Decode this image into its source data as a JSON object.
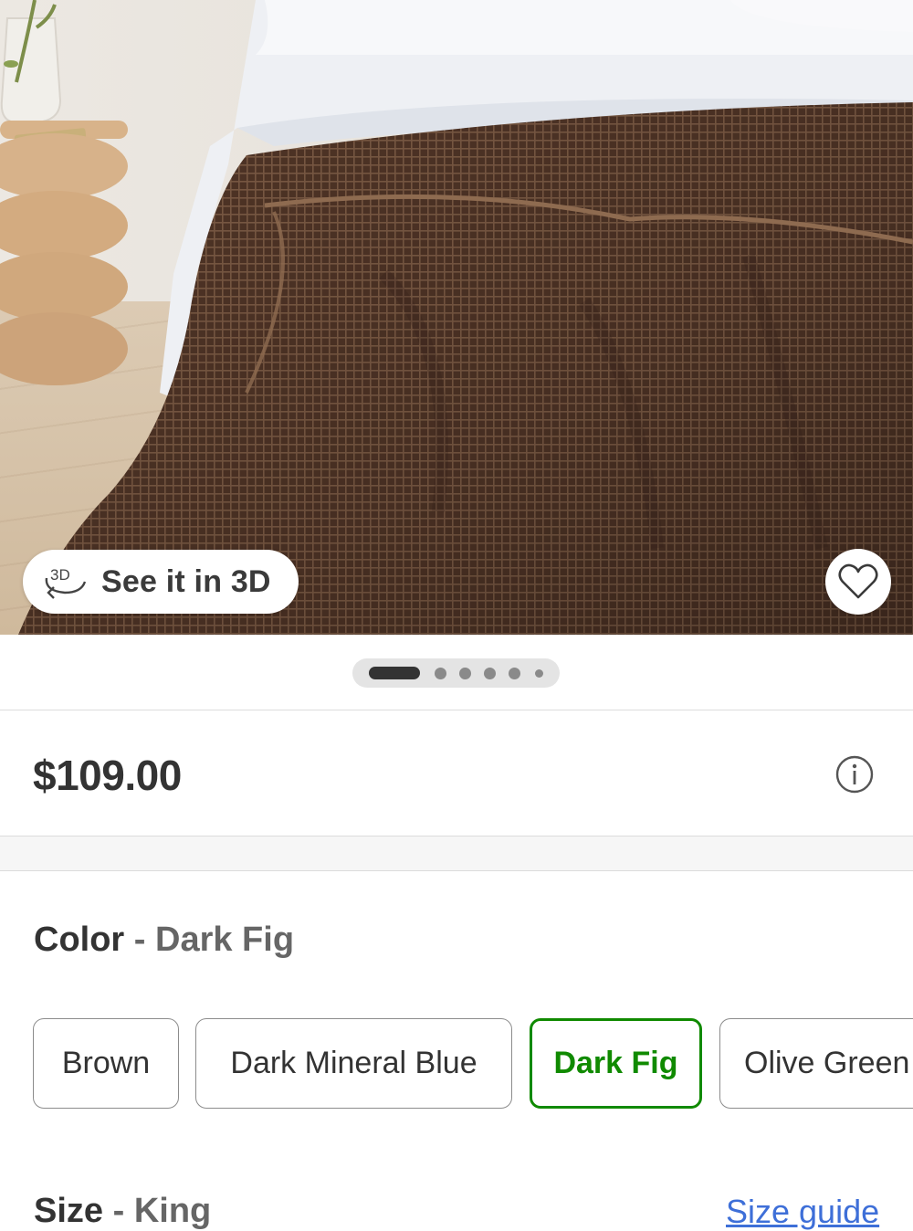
{
  "hero": {
    "see_3d_label": "See it in 3D",
    "see_3d_icon": "3d-rotate-icon",
    "favorite_icon": "heart-outline-icon"
  },
  "carousel": {
    "total_slides": 6,
    "active_slide": 1
  },
  "product": {
    "price": "$109.00",
    "info_icon": "info-circle-icon"
  },
  "color": {
    "label": "Color",
    "separator": "-",
    "selected": "Dark Fig",
    "options": [
      "Brown",
      "Dark Mineral Blue",
      "Dark Fig",
      "Olive Green"
    ],
    "selected_color": "#108a00"
  },
  "size": {
    "label": "Size",
    "separator": "-",
    "selected": "King",
    "guide_link": "Size guide",
    "link_color": "#3e6fd8"
  }
}
